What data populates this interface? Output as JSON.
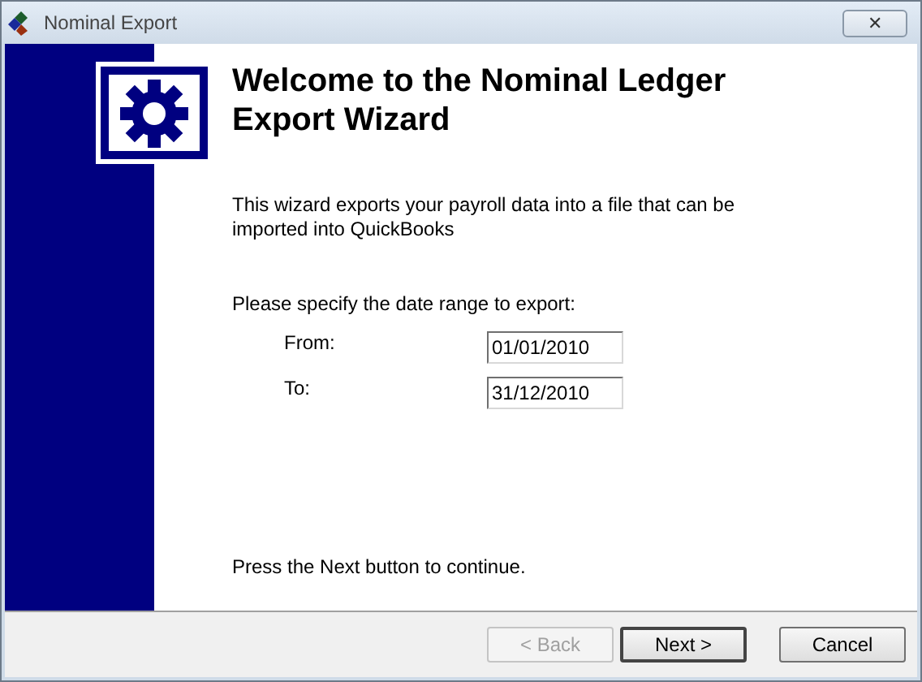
{
  "window": {
    "title": "Nominal Export",
    "close_label": "✕"
  },
  "heading": "Welcome to the Nominal Ledger Export Wizard",
  "intro": "This wizard exports your payroll data into a file that can be imported into QuickBooks",
  "range_prompt": "Please specify the date range to export:",
  "fields": [
    {
      "label": "From:",
      "value": "01/01/2010"
    },
    {
      "label": "To:",
      "value": "31/12/2010"
    }
  ],
  "footer_note": "Press the Next button to continue.",
  "buttons": [
    {
      "label": "< Back",
      "disabled": true,
      "default": false
    },
    {
      "label": "Next >",
      "disabled": false,
      "default": true
    },
    {
      "label": "Cancel",
      "disabled": false,
      "default": false
    }
  ]
}
